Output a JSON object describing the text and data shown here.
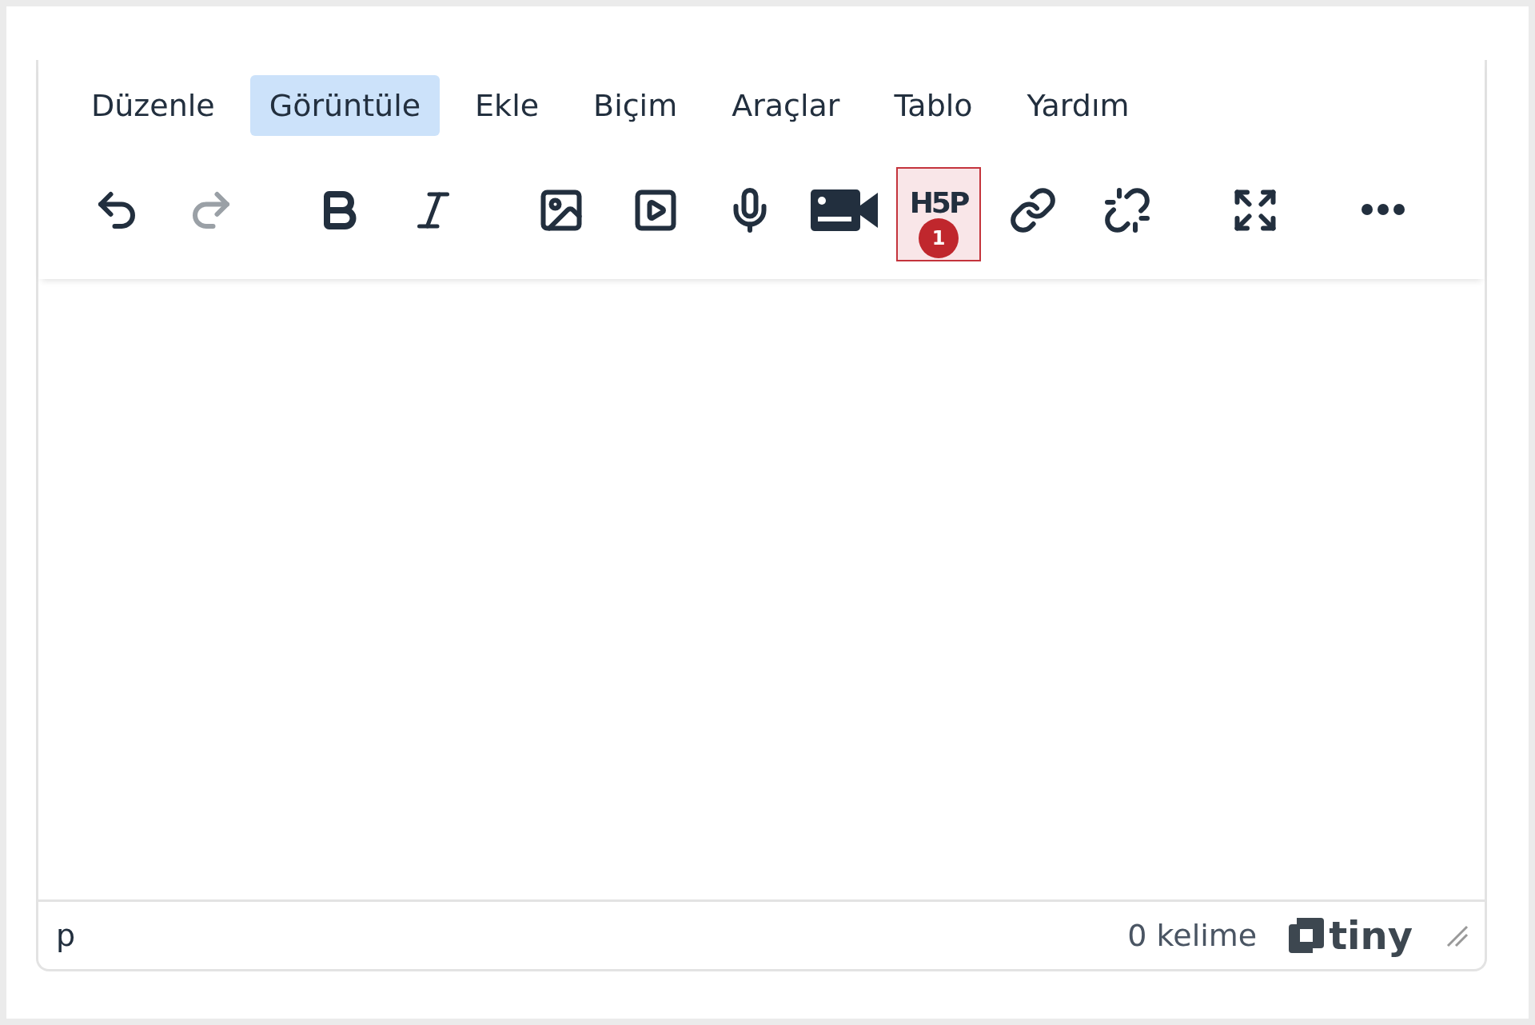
{
  "menubar": [
    {
      "label": "Düzenle",
      "selected": false
    },
    {
      "label": "Görüntüle",
      "selected": true
    },
    {
      "label": "Ekle",
      "selected": false
    },
    {
      "label": "Biçim",
      "selected": false
    },
    {
      "label": "Araçlar",
      "selected": false
    },
    {
      "label": "Tablo",
      "selected": false
    },
    {
      "label": "Yardım",
      "selected": false
    }
  ],
  "toolbar_groups": [
    [
      {
        "kind": "undo",
        "disabled": false
      },
      {
        "kind": "redo",
        "disabled": true
      }
    ],
    [
      {
        "kind": "bold",
        "disabled": false
      },
      {
        "kind": "italic",
        "disabled": false
      }
    ],
    [
      {
        "kind": "image",
        "disabled": false
      },
      {
        "kind": "media",
        "disabled": false
      },
      {
        "kind": "microphone",
        "disabled": false
      },
      {
        "kind": "camera",
        "disabled": false
      },
      {
        "kind": "h5p",
        "disabled": false,
        "label": "H5P",
        "badge": "1"
      },
      {
        "kind": "link",
        "disabled": false
      },
      {
        "kind": "unlink",
        "disabled": false
      }
    ],
    [
      {
        "kind": "fullscreen",
        "disabled": false
      }
    ],
    [
      {
        "kind": "more",
        "disabled": false
      }
    ]
  ],
  "status_bar": {
    "path": "p",
    "word_count": "0 kelime",
    "brand": "tiny"
  }
}
